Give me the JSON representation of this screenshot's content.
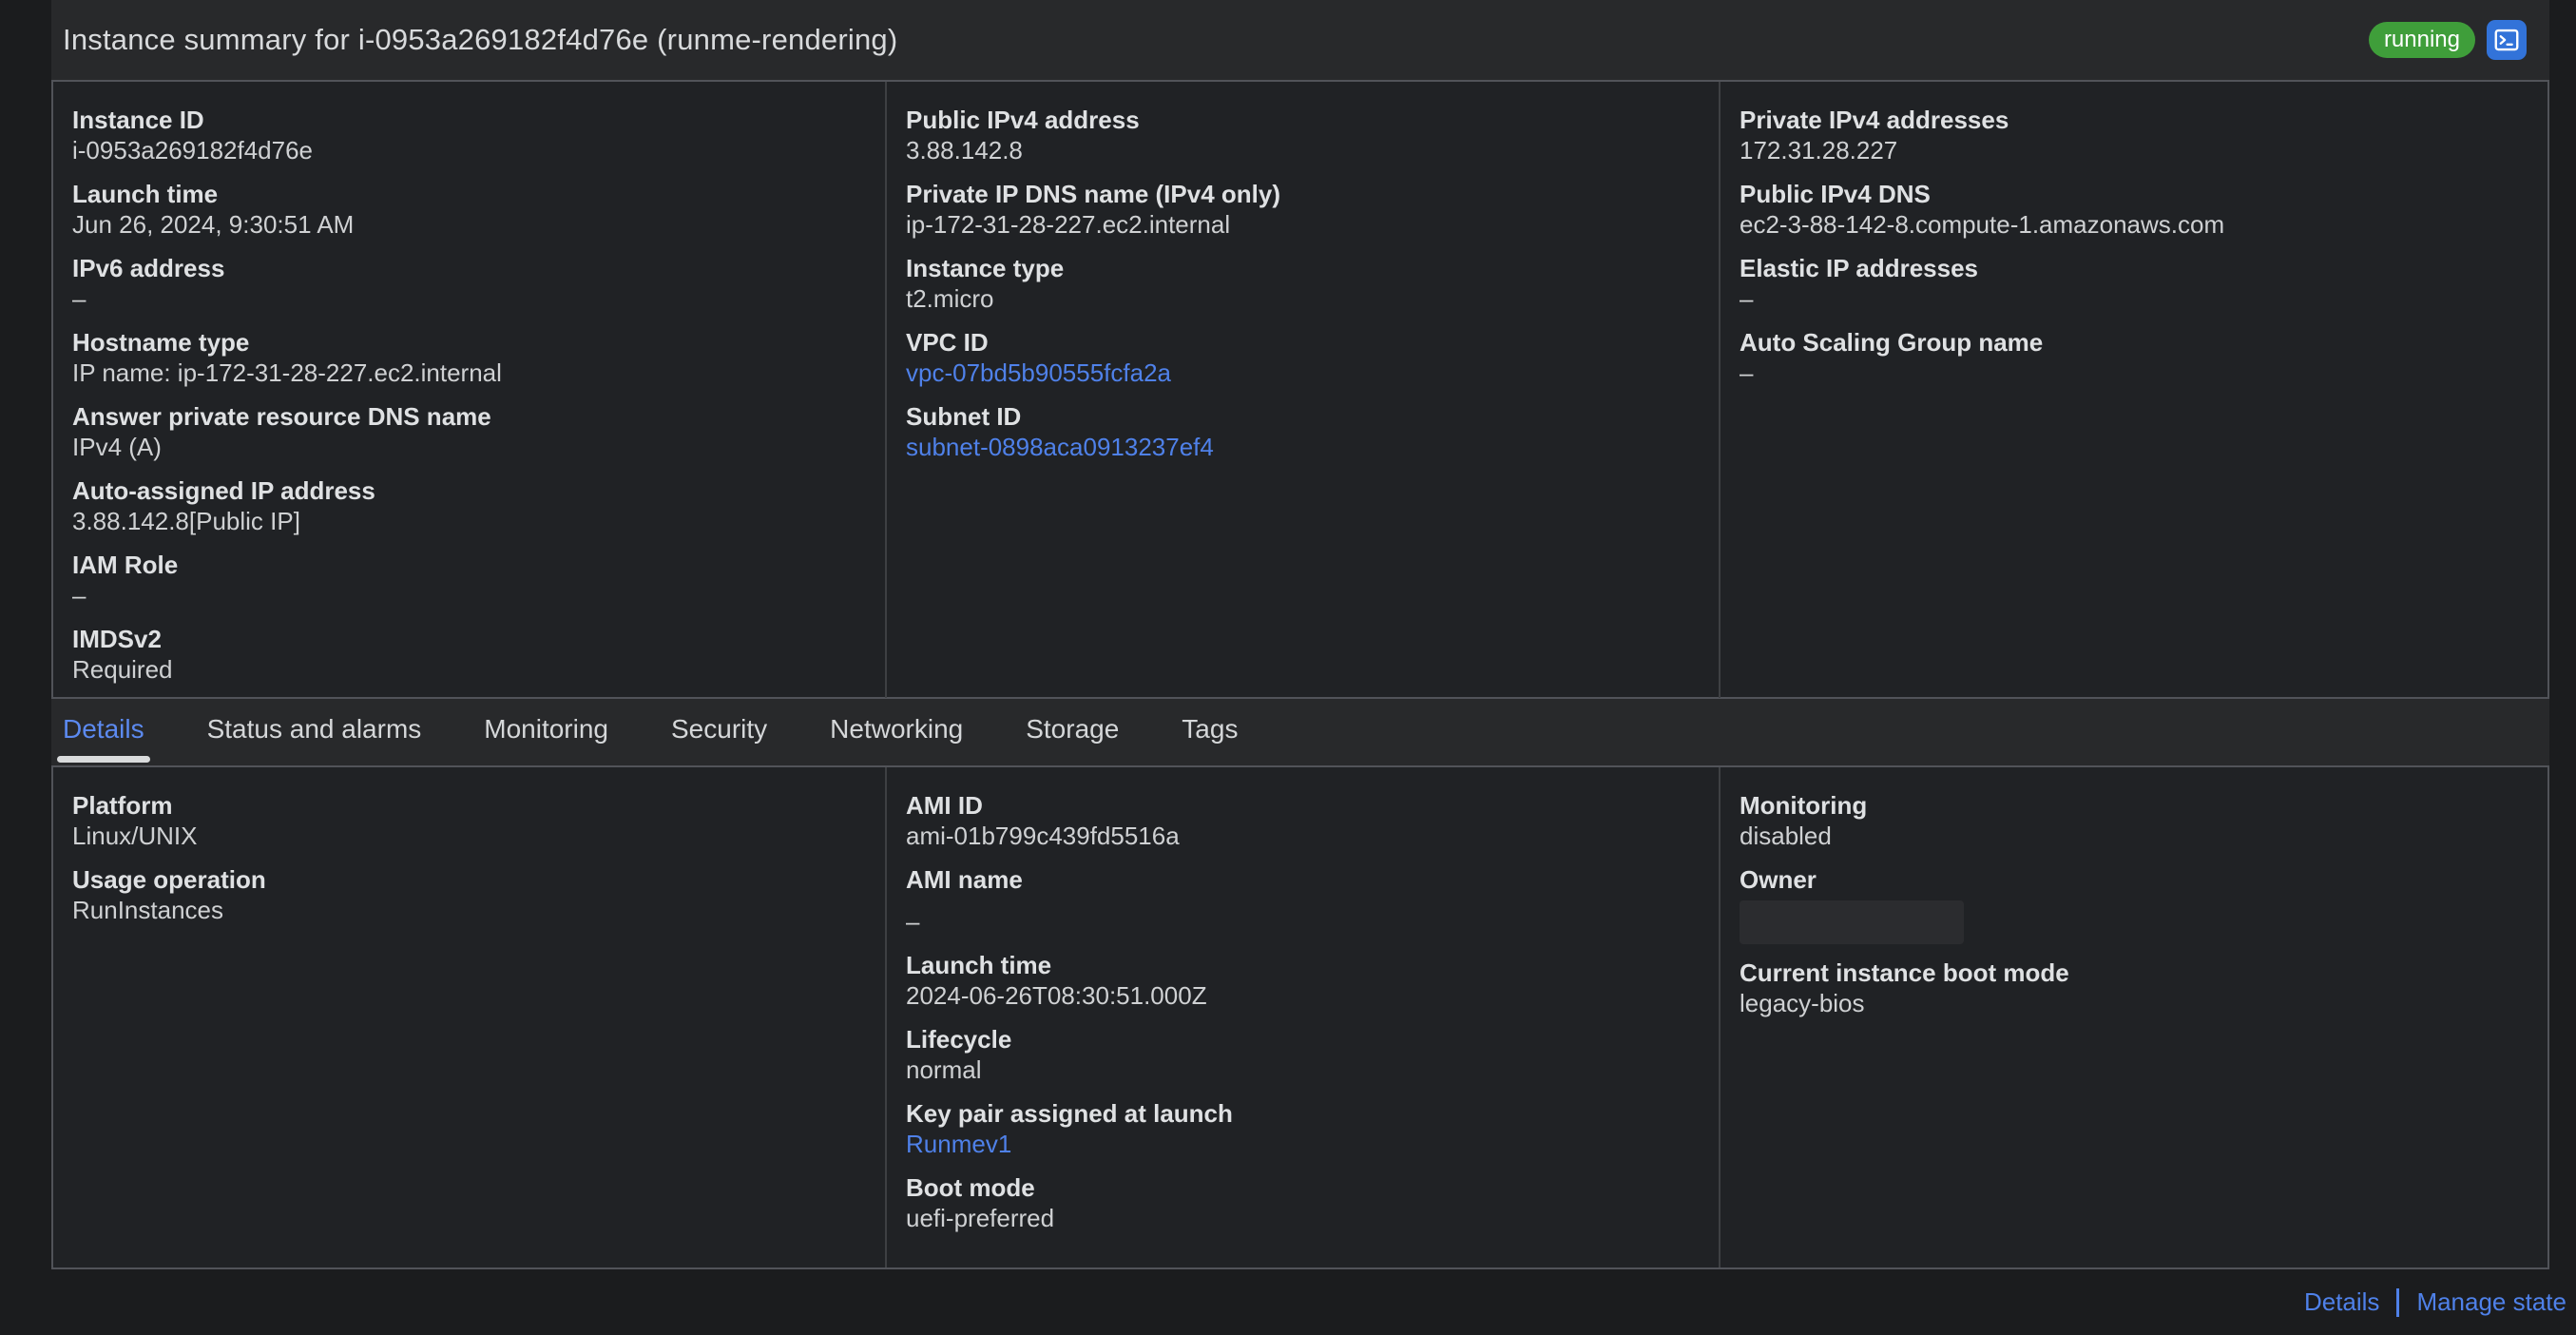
{
  "header": {
    "title": "Instance summary for i-0953a269182f4d76e (runme-rendering)",
    "status_badge": "running"
  },
  "summary": {
    "col1": [
      {
        "label": "Instance ID",
        "value": "i-0953a269182f4d76e"
      },
      {
        "label": "Launch time",
        "value": "Jun 26, 2024, 9:30:51 AM"
      },
      {
        "label": "IPv6 address",
        "value": "–"
      },
      {
        "label": "Hostname type",
        "value": "IP name: ip-172-31-28-227.ec2.internal"
      },
      {
        "label": "Answer private resource DNS name",
        "value": "IPv4 (A)"
      },
      {
        "label": "Auto-assigned IP address",
        "value": "3.88.142.8[Public IP]"
      },
      {
        "label": "IAM Role",
        "value": "–"
      },
      {
        "label": "IMDSv2",
        "value": "Required"
      }
    ],
    "col2": [
      {
        "label": "Public IPv4 address",
        "value": "3.88.142.8"
      },
      {
        "label": "Private IP DNS name (IPv4 only)",
        "value": "ip-172-31-28-227.ec2.internal"
      },
      {
        "label": "Instance type",
        "value": "t2.micro"
      },
      {
        "label": "VPC ID",
        "value": "vpc-07bd5b90555fcfa2a"
      },
      {
        "label": "Subnet ID",
        "value": "subnet-0898aca0913237ef4"
      }
    ],
    "col3": [
      {
        "label": "Private IPv4 addresses",
        "value": "172.31.28.227"
      },
      {
        "label": "Public IPv4 DNS",
        "value": "ec2-3-88-142-8.compute-1.amazonaws.com"
      },
      {
        "label": "Elastic IP addresses",
        "value": "–"
      },
      {
        "label": "Auto Scaling Group name",
        "value": "–"
      }
    ]
  },
  "tabs": {
    "items": [
      "Details",
      "Status and alarms",
      "Monitoring",
      "Security",
      "Networking",
      "Storage",
      "Tags"
    ],
    "active": "Details"
  },
  "details": {
    "col1": [
      {
        "label": "Platform",
        "value": "Linux/UNIX"
      },
      {
        "label": "Usage operation",
        "value": "RunInstances"
      }
    ],
    "col2": [
      {
        "label": "AMI ID",
        "value": "ami-01b799c439fd5516a"
      },
      {
        "label": "AMI name",
        "value": "–"
      },
      {
        "label": "Launch time",
        "value": "2024-06-26T08:30:51.000Z"
      },
      {
        "label": "Lifecycle",
        "value": "normal"
      },
      {
        "label": "Key pair assigned at launch",
        "value": "Runmev1"
      },
      {
        "label": "Boot mode",
        "value": "uefi-preferred"
      }
    ],
    "col3": [
      {
        "label": "Monitoring",
        "value": "disabled"
      },
      {
        "label": "Owner",
        "value": ""
      },
      {
        "label": "Current instance boot mode",
        "value": "legacy-bios"
      }
    ]
  },
  "footer": {
    "details_label": "Details",
    "manage_state_label": "Manage state"
  },
  "colors": {
    "badge_green": "#3f9e3a",
    "terminal_button_blue": "#3273d9",
    "link_blue": "#4f81e9",
    "tab_active_blue": "#5c8af0"
  }
}
